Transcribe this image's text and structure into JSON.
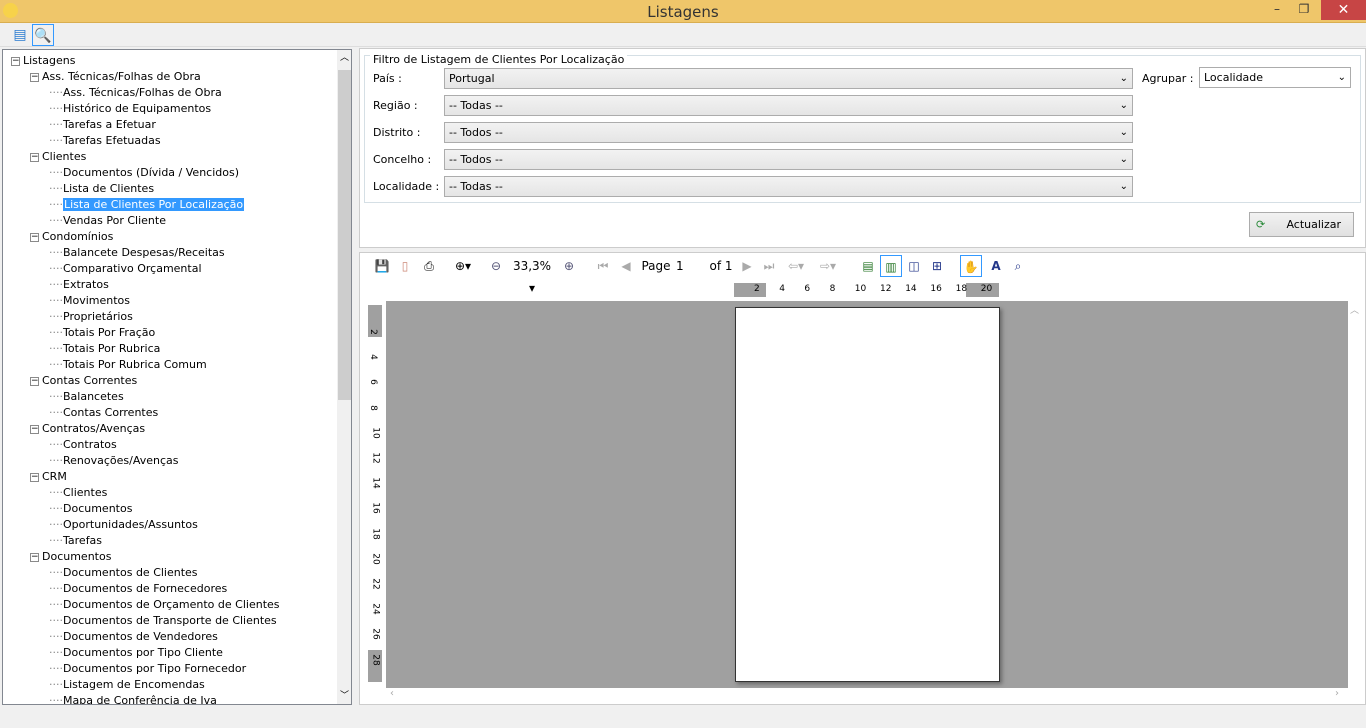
{
  "window": {
    "title": "Listagens",
    "minimize": "–",
    "restore": "❐",
    "close": "✕"
  },
  "toolbar": {
    "refresh_icon": "report-refresh-icon",
    "search_icon": "magnifier-icon"
  },
  "tree": [
    {
      "label": "Listagens",
      "level": 0,
      "expander": "−"
    },
    {
      "label": "Ass. Técnicas/Folhas de Obra",
      "level": 1,
      "expander": "−"
    },
    {
      "label": "Ass. Técnicas/Folhas de Obra",
      "level": 2
    },
    {
      "label": "Histórico de Equipamentos",
      "level": 2
    },
    {
      "label": "Tarefas a Efetuar",
      "level": 2
    },
    {
      "label": "Tarefas Efetuadas",
      "level": 2
    },
    {
      "label": "Clientes",
      "level": 1,
      "expander": "−"
    },
    {
      "label": "Documentos (Dívida / Vencidos)",
      "level": 2
    },
    {
      "label": "Lista de Clientes",
      "level": 2
    },
    {
      "label": "Lista de Clientes Por Localização",
      "level": 2,
      "selected": true
    },
    {
      "label": "Vendas Por Cliente",
      "level": 2
    },
    {
      "label": "Condomínios",
      "level": 1,
      "expander": "−"
    },
    {
      "label": "Balancete Despesas/Receitas",
      "level": 2
    },
    {
      "label": "Comparativo Orçamental",
      "level": 2
    },
    {
      "label": "Extratos",
      "level": 2
    },
    {
      "label": "Movimentos",
      "level": 2
    },
    {
      "label": "Proprietários",
      "level": 2
    },
    {
      "label": "Totais Por Fração",
      "level": 2
    },
    {
      "label": "Totais Por Rubrica",
      "level": 2
    },
    {
      "label": "Totais Por Rubrica Comum",
      "level": 2
    },
    {
      "label": "Contas Correntes",
      "level": 1,
      "expander": "−"
    },
    {
      "label": "Balancetes",
      "level": 2
    },
    {
      "label": "Contas Correntes",
      "level": 2
    },
    {
      "label": "Contratos/Avenças",
      "level": 1,
      "expander": "−"
    },
    {
      "label": "Contratos",
      "level": 2
    },
    {
      "label": "Renovações/Avenças",
      "level": 2
    },
    {
      "label": "CRM",
      "level": 1,
      "expander": "−"
    },
    {
      "label": "Clientes",
      "level": 2
    },
    {
      "label": "Documentos",
      "level": 2
    },
    {
      "label": "Oportunidades/Assuntos",
      "level": 2
    },
    {
      "label": "Tarefas",
      "level": 2
    },
    {
      "label": "Documentos",
      "level": 1,
      "expander": "−"
    },
    {
      "label": "Documentos de Clientes",
      "level": 2
    },
    {
      "label": "Documentos de Fornecedores",
      "level": 2
    },
    {
      "label": "Documentos de Orçamento de Clientes",
      "level": 2
    },
    {
      "label": "Documentos de Transporte de Clientes",
      "level": 2
    },
    {
      "label": "Documentos de Vendedores",
      "level": 2
    },
    {
      "label": "Documentos por Tipo Cliente",
      "level": 2
    },
    {
      "label": "Documentos por Tipo Fornecedor",
      "level": 2
    },
    {
      "label": "Listagem de Encomendas",
      "level": 2
    },
    {
      "label": "Mapa de Conferência de Iva",
      "level": 2
    }
  ],
  "filter": {
    "title": "Filtro de Listagem de Clientes Por Localização",
    "pais_label": "País :",
    "pais_value": "Portugal",
    "regiao_label": "Região :",
    "regiao_value": "-- Todas --",
    "distrito_label": "Distrito :",
    "distrito_value": "-- Todos --",
    "concelho_label": "Concelho :",
    "concelho_value": "-- Todos --",
    "localidade_label": "Localidade :",
    "localidade_value": "-- Todas --",
    "agrupar_label": "Agrupar :",
    "agrupar_value": "Localidade",
    "refresh_button": "Actualizar"
  },
  "viewer": {
    "zoom": "33,3%",
    "page_label": "Page",
    "page_value": "1",
    "page_of": "of 1",
    "hruler": [
      "2",
      "4",
      "6",
      "8",
      "10",
      "12",
      "14",
      "16",
      "18",
      "20"
    ],
    "vruler": [
      "2",
      "4",
      "6",
      "8",
      "10",
      "12",
      "14",
      "16",
      "18",
      "20",
      "22",
      "24",
      "26",
      "28"
    ]
  }
}
